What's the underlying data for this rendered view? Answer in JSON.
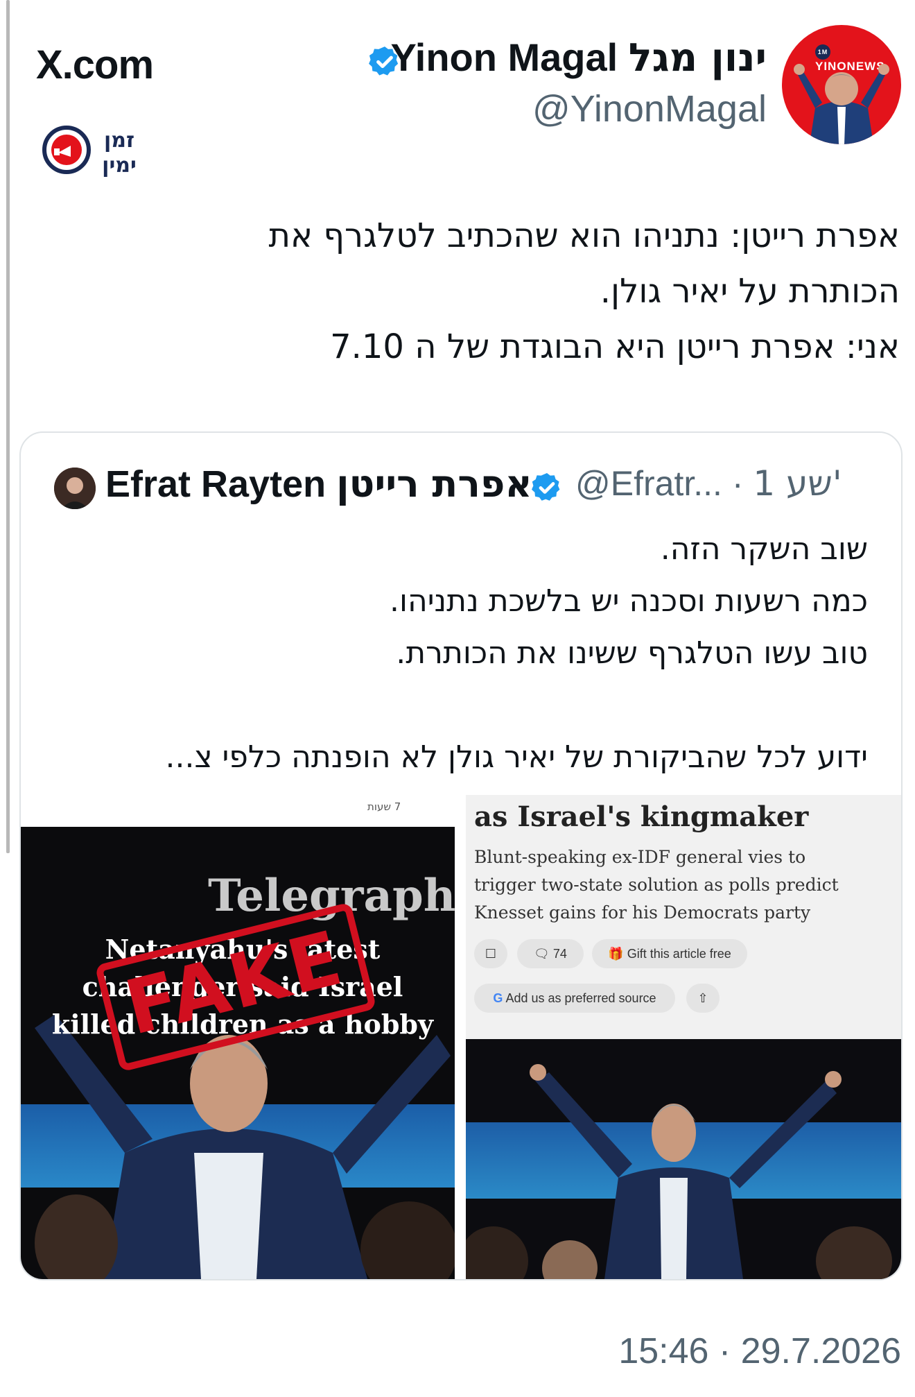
{
  "watermark": {
    "site": "X.com",
    "logo_text_line1": "זמן",
    "logo_text_line2": "ימין"
  },
  "author": {
    "name_en": "Yinon Magal",
    "name_he": "ינון מגל",
    "handle": "@YinonMagal",
    "verified": true,
    "avatar_brand": "YINONEWS",
    "avatar_badge": "1M"
  },
  "tweet": {
    "lines": [
      "אפרת רייטן: נתניהו הוא שהכתיב לטלגרף את",
      "הכותרת על יאיר גולן.",
      "אני: אפרת רייטן היא הבוגדת של ה 7.10"
    ]
  },
  "quote": {
    "author_en": "Efrat Rayten",
    "author_he": "אפרת רייטן",
    "handle": "@Efratr...",
    "time": "1 שע'",
    "verified": true,
    "lines": [
      "שוב השקר הזה.",
      "כמה רשעות וסכנה יש בלשכת נתניהו.",
      "טוב עשו הטלגרף ששינו את הכותרת.",
      "",
      "ידוע לכל שהביקורת של יאיר גולן לא הופנתה כלפי צ..."
    ],
    "left_image": {
      "time_badge": "7 שעות",
      "logo": "Telegraph",
      "headline": [
        "Netanyahu's latest",
        "challenger said Israel",
        "killed children as a hobby"
      ],
      "stamp": "FAKE"
    },
    "right_image": {
      "title": "as Israel's kingmaker",
      "subtitle": [
        "Blunt-speaking ex-IDF general vies to",
        "trigger two-state solution as polls predict",
        "Knesset gains for his Democrats party"
      ],
      "comments": "74",
      "gift_label": "Gift this article free",
      "source_label": "Add us as preferred source"
    }
  },
  "timestamp": "15:46 · 29.7.2026",
  "colors": {
    "verified": "#1d9bf0",
    "avatar_red": "#e3131b",
    "stamp_red": "#d10f1f",
    "muted": "#536471"
  }
}
